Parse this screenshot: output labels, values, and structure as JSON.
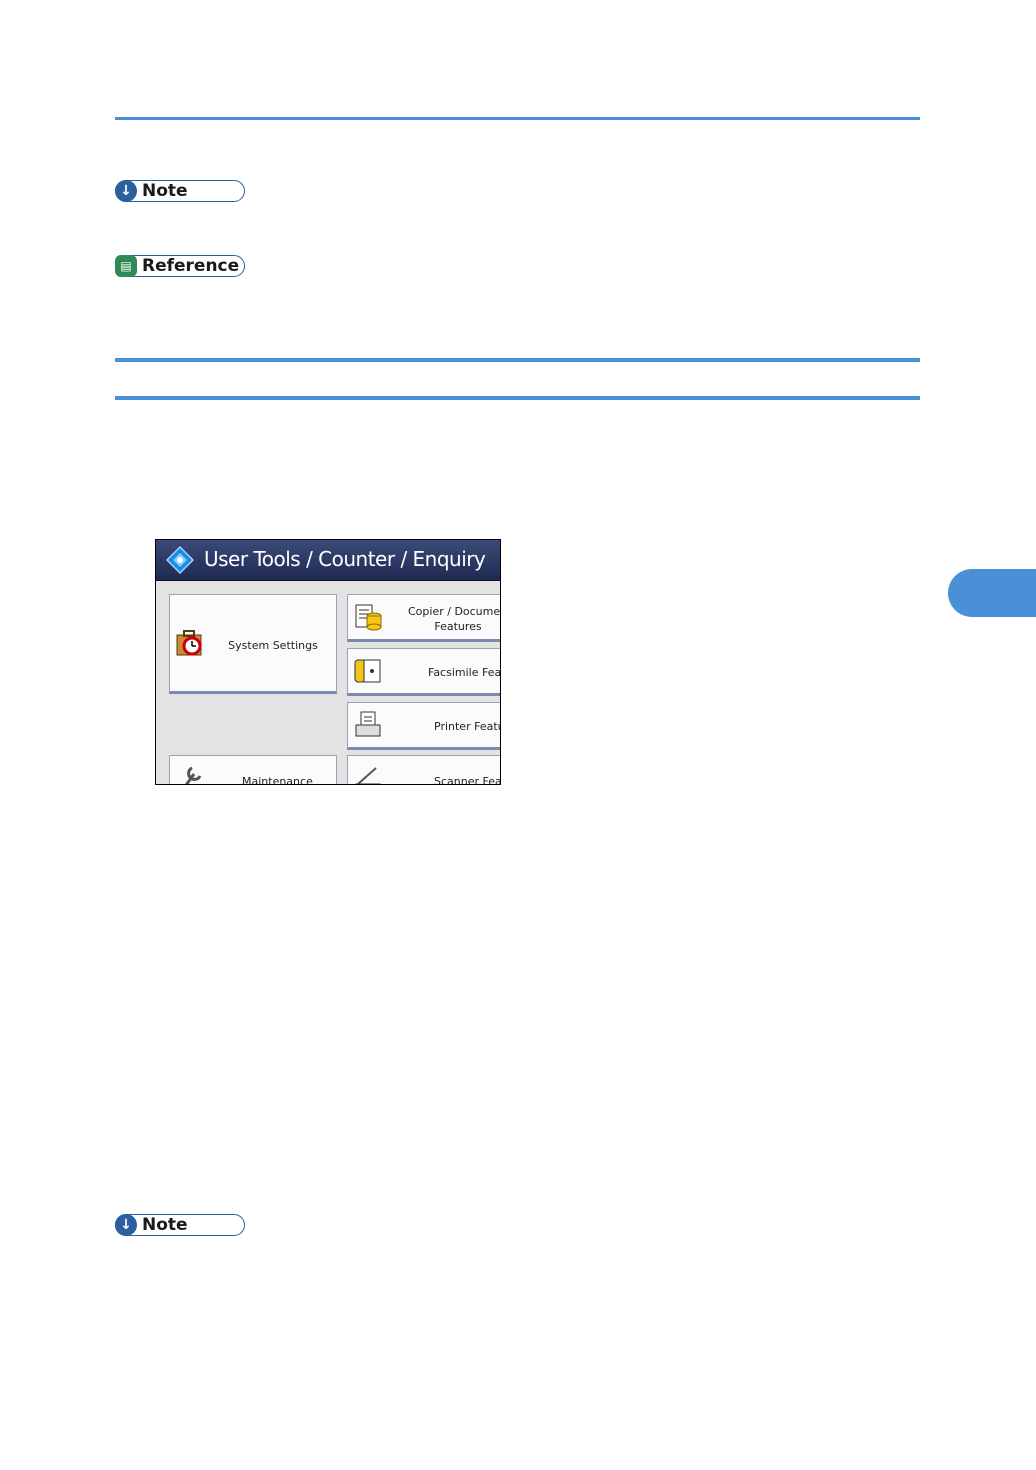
{
  "note_label": "Note",
  "reference_label": "Reference",
  "note_label_2": "Note",
  "screen": {
    "title": "User Tools / Counter / Enquiry",
    "buttons": {
      "system_settings": "System Settings",
      "copier_line1": "Copier / Document",
      "copier_line2": "Features",
      "facsimile": "Facsimile Features",
      "printer": "Printer Features",
      "maintenance": "Maintenance",
      "scanner": "Scanner Features"
    }
  },
  "colors": {
    "accent": "#4a90d6",
    "badge": "#2b5f9e",
    "titlebar": "#27335e"
  }
}
